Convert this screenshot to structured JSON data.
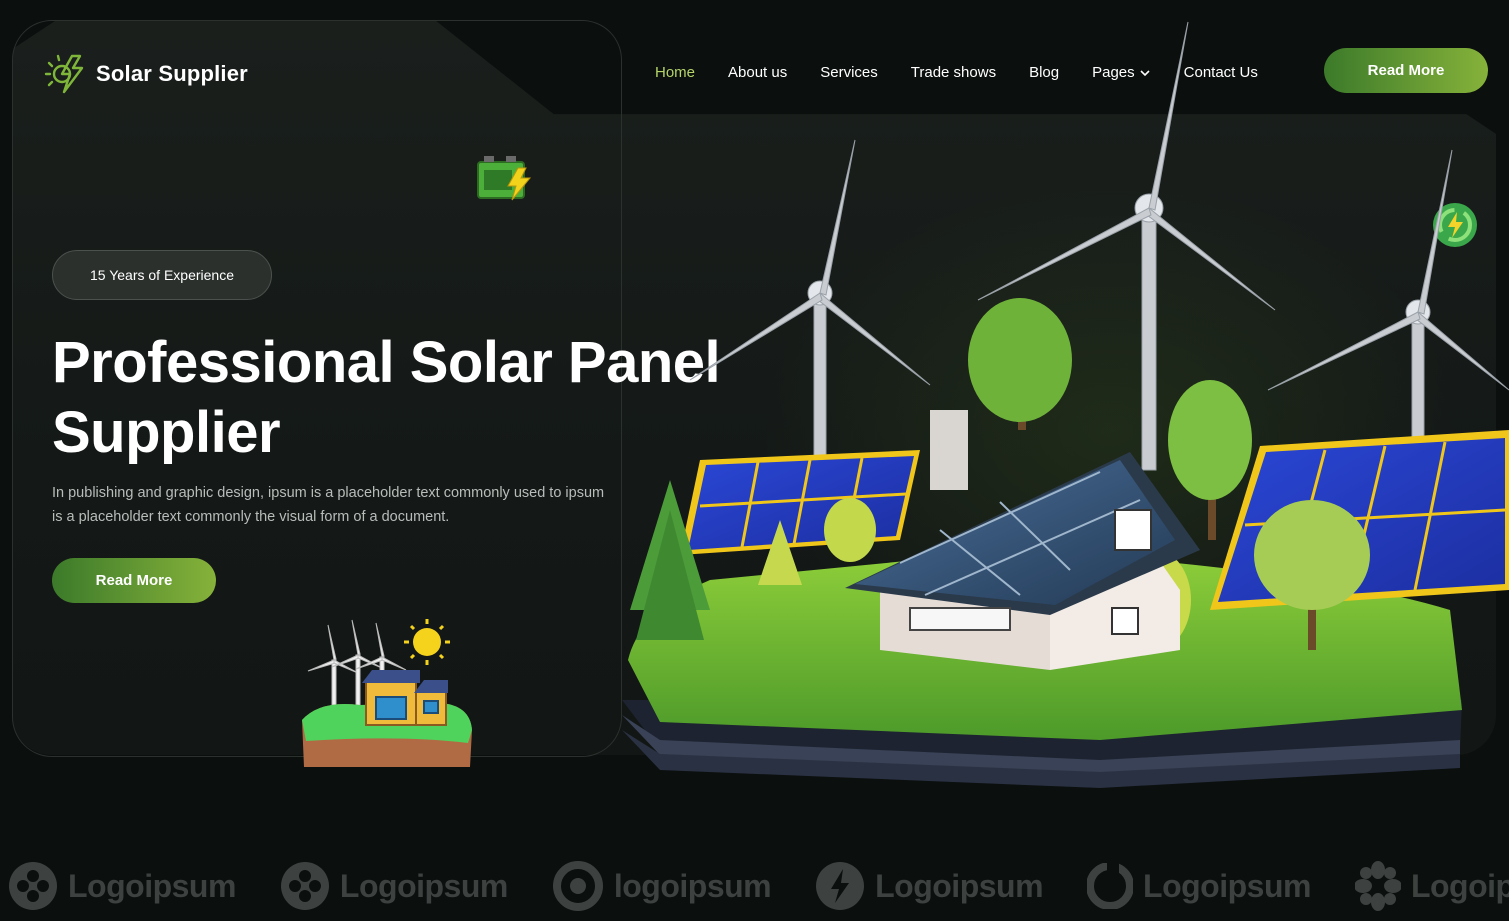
{
  "brand": {
    "name": "Solar Supplier",
    "icon": "solar-bolt-icon",
    "accent": "#7fb63a"
  },
  "nav": {
    "items": [
      {
        "label": "Home",
        "active": true
      },
      {
        "label": "About us"
      },
      {
        "label": "Services"
      },
      {
        "label": "Trade shows"
      },
      {
        "label": "Blog"
      },
      {
        "label": "Pages",
        "has_dropdown": true
      },
      {
        "label": "Contact Us"
      }
    ],
    "cta_label": "Read More"
  },
  "hero": {
    "badge": "15 Years of Experience",
    "headline": "Professional Solar Panel Supplier",
    "description": "In publishing and graphic design, ipsum is a placeholder text commonly used to ipsum is a placeholder text commonly the visual form of a document.",
    "cta_label": "Read More"
  },
  "logos": [
    {
      "name": "Logoipsum",
      "icon": "clover-icon"
    },
    {
      "name": "Logoipsum",
      "icon": "clover-icon"
    },
    {
      "name": "logoipsum",
      "icon": "ring-icon"
    },
    {
      "name": "Logoipsum",
      "icon": "bolt-circle-icon"
    },
    {
      "name": "Logoipsum",
      "icon": "crescent-icon"
    },
    {
      "name": "Logoipsum",
      "icon": "flower-icon"
    }
  ],
  "colors": {
    "background": "#0b0f0e",
    "panel": "#171c19",
    "button_start": "#3c7a2a",
    "button_end": "#86b23a",
    "active_nav": "#b6d46a"
  }
}
